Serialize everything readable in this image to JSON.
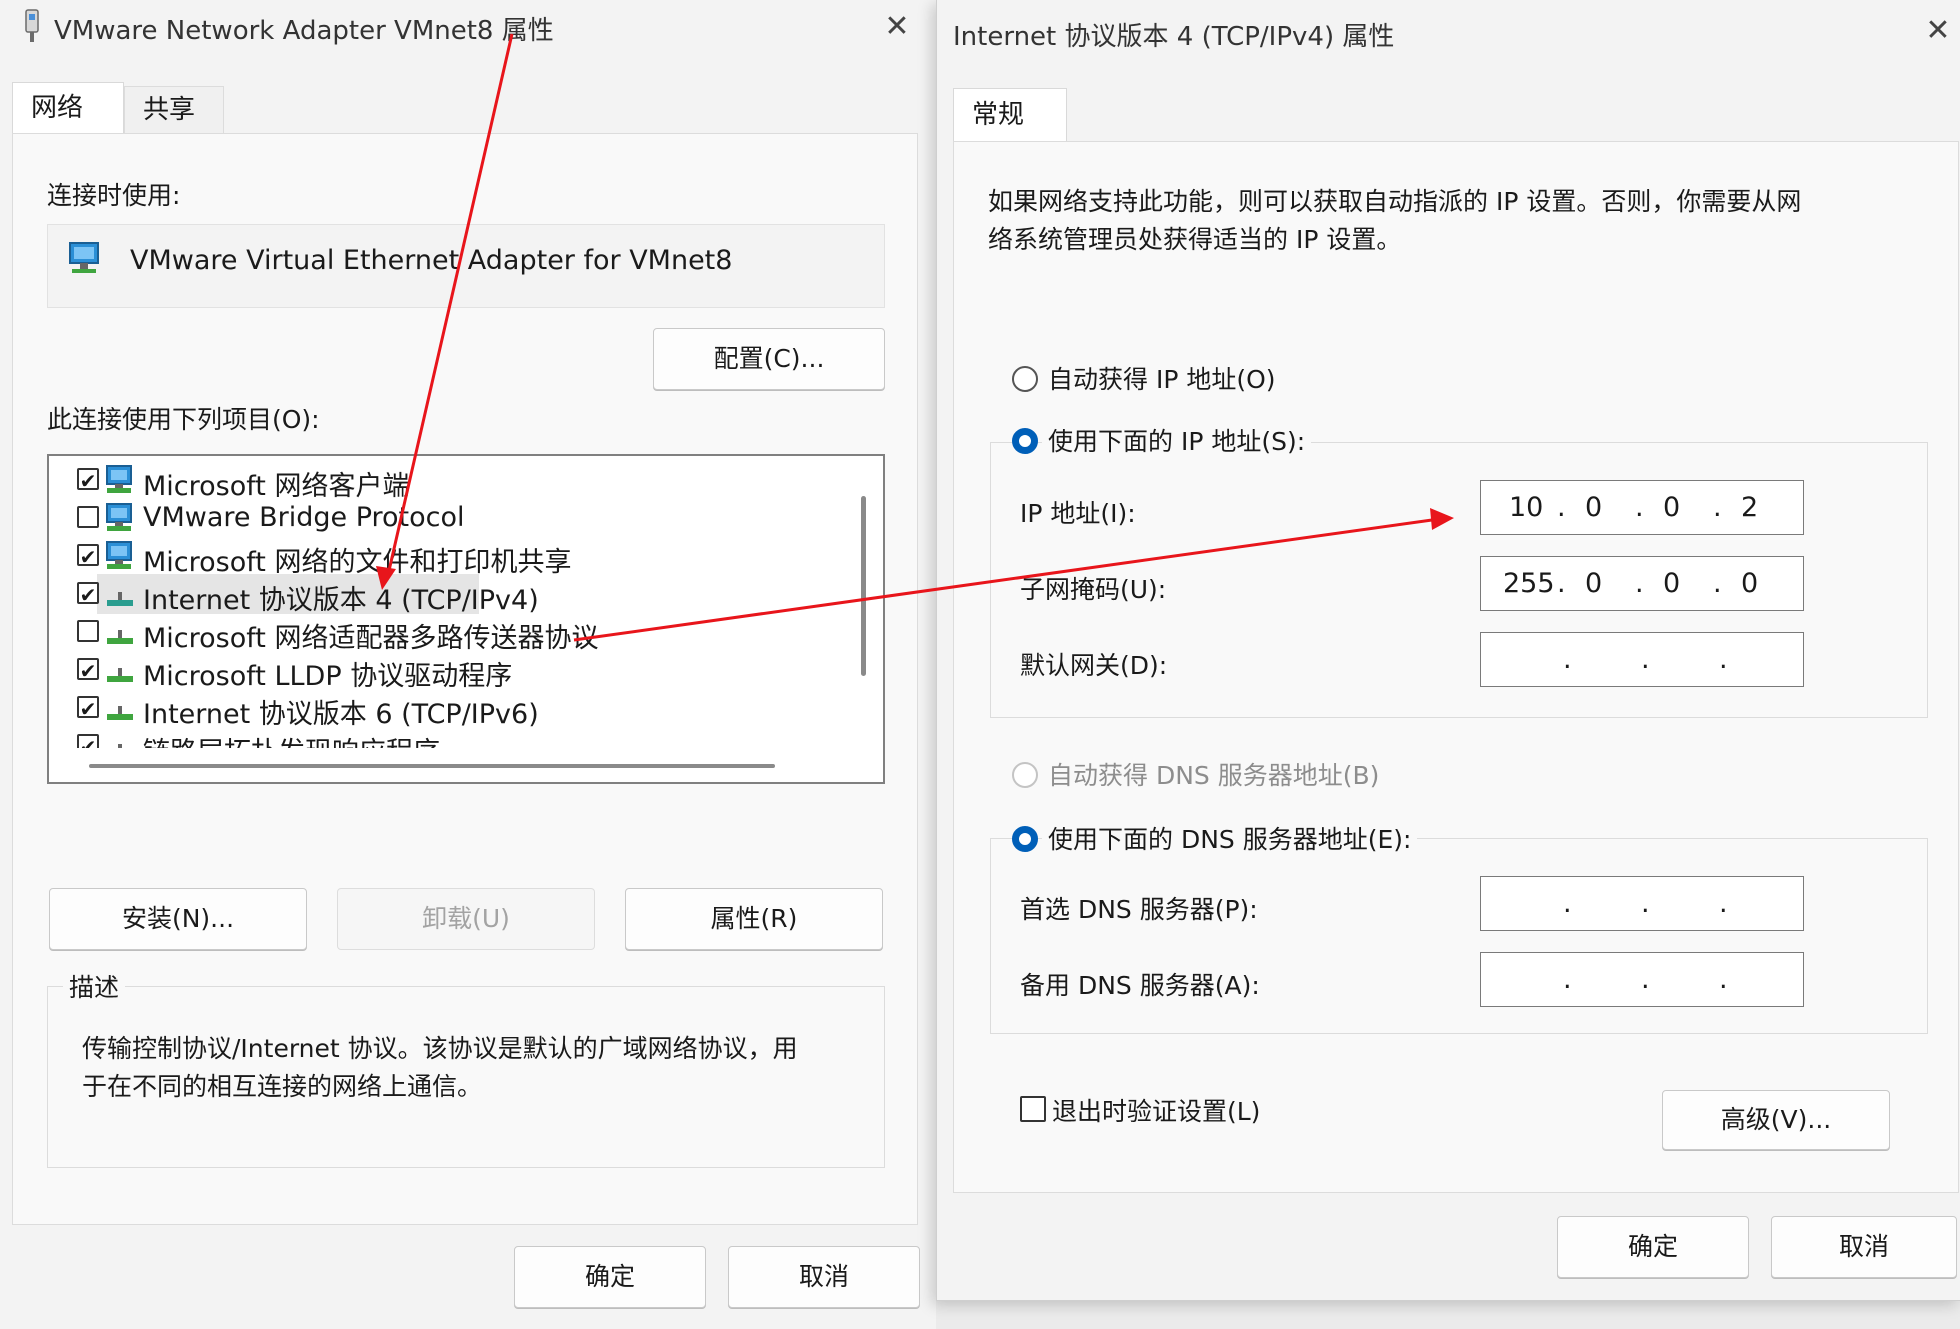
{
  "left_dialog": {
    "title": "VMware Network Adapter VMnet8 属性",
    "tabs": [
      {
        "label": "网络"
      },
      {
        "label": "共享"
      }
    ],
    "connect_using_label": "连接时使用:",
    "adapter_name": "VMware Virtual Ethernet Adapter for VMnet8",
    "configure_label": "配置(C)...",
    "items_label": "此连接使用下列项目(O):",
    "items": [
      {
        "label": "Microsoft 网络客户端",
        "checked": true
      },
      {
        "label": "VMware Bridge Protocol",
        "checked": false
      },
      {
        "label": "Microsoft 网络的文件和打印机共享",
        "checked": true
      },
      {
        "label": "Internet 协议版本 4 (TCP/IPv4)",
        "checked": true
      },
      {
        "label": "Microsoft 网络适配器多路传送器协议",
        "checked": false
      },
      {
        "label": "Microsoft LLDP 协议驱动程序",
        "checked": true
      },
      {
        "label": "Internet 协议版本 6 (TCP/IPv6)",
        "checked": true
      },
      {
        "label": "链路层拓扑发现响应程序",
        "checked": true
      }
    ],
    "install_label": "安装(N)...",
    "uninstall_label": "卸载(U)",
    "properties_label": "属性(R)",
    "description_heading": "描述",
    "description_text_1": "传输控制协议/Internet 协议。该协议是默认的广域网络协议，用",
    "description_text_2": "于在不同的相互连接的网络上通信。",
    "ok_label": "确定",
    "cancel_label": "取消",
    "check_mark": "✔",
    "close_glyph": "✕"
  },
  "right_dialog": {
    "title": "Internet 协议版本 4 (TCP/IPv4) 属性",
    "tab_general": "常规",
    "intro_line_1": "如果网络支持此功能，则可以获取自动指派的 IP 设置。否则，你需要从网",
    "intro_line_2": "络系统管理员处获得适当的 IP 设置。",
    "auto_ip_label": "自动获得 IP 地址(O)",
    "manual_ip_label": "使用下面的 IP 地址(S):",
    "ip_address_label": "IP 地址(I):",
    "ip_address": [
      "10",
      "0",
      "0",
      "2"
    ],
    "subnet_label": "子网掩码(U):",
    "subnet_mask": [
      "255",
      "0",
      "0",
      "0"
    ],
    "gateway_label": "默认网关(D):",
    "auto_dns_label": "自动获得 DNS 服务器地址(B)",
    "manual_dns_label": "使用下面的 DNS 服务器地址(E):",
    "preferred_dns_label": "首选 DNS 服务器(P):",
    "alternate_dns_label": "备用 DNS 服务器(A):",
    "validate_label": "退出时验证设置(L)",
    "advanced_label": "高级(V)...",
    "ok_label": "确定",
    "cancel_label": "取消",
    "ip_dot": ".",
    "close_glyph": "✕"
  },
  "colors": {
    "accent": "#005fb8",
    "annotation_arrow": "#e8151b",
    "selected_row": "#e5e5e5",
    "adapter_icon": "#2b8fd6",
    "protocol_icon": "#3fa53f"
  }
}
